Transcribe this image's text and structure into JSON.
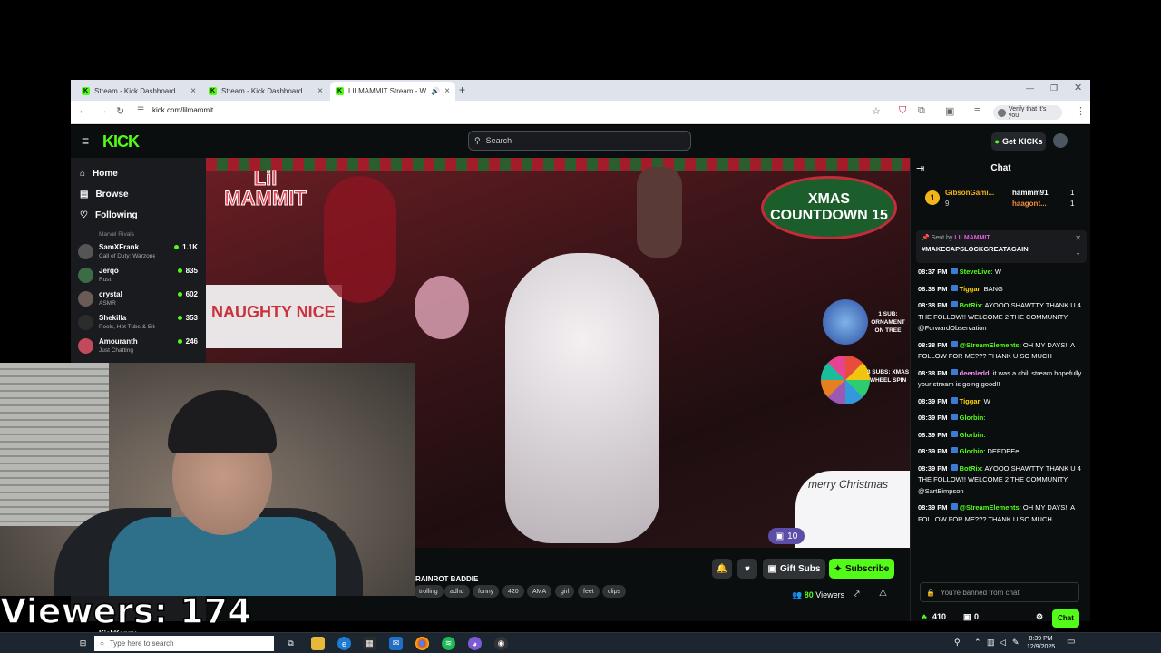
{
  "browser": {
    "tabs": [
      {
        "title": "Stream - Kick Dashboard"
      },
      {
        "title": "Stream - Kick Dashboard"
      },
      {
        "title": "LILMAMMIT Stream - Watc"
      }
    ],
    "url": "kick.com/lilmammit",
    "verify_label": "Verify that it's you"
  },
  "kick": {
    "logo": "KICK",
    "search_placeholder": "Search",
    "get_kicks": "Get KICKs",
    "nav": [
      {
        "label": "Home"
      },
      {
        "label": "Browse"
      },
      {
        "label": "Following"
      }
    ],
    "channels": [
      {
        "name": "Marvel Rivals",
        "game": "",
        "viewers": ""
      },
      {
        "name": "SamXFrank",
        "game": "Call of Duty: Warzone",
        "viewers": "1.1K"
      },
      {
        "name": "Jerqo",
        "game": "Rust",
        "viewers": "835"
      },
      {
        "name": "crystal",
        "game": "ASMR",
        "viewers": "602"
      },
      {
        "name": "Shekilla",
        "game": "Pools, Hot Tubs & Biki...",
        "viewers": "353"
      },
      {
        "name": "Amouranth",
        "game": "Just Chatting",
        "viewers": "246"
      },
      {
        "name": "KickKenny",
        "game": "",
        "viewers": ""
      }
    ],
    "video": {
      "board_text": "NAUGHTY  NICE",
      "countdown": "XMAS COUNTDOWN 15",
      "sub1": "1 SUB: ORNAMENT ON TREE",
      "sub3": "3 SUBS: XMAS WHEEL SPIN",
      "merry": "merry Christmas",
      "sub_count": "10"
    },
    "stream_title": "RAINROT BADDIE",
    "tags": [
      "trolling",
      "adhd",
      "funny",
      "420",
      "AMA",
      "girl",
      "feet",
      "clips"
    ],
    "gift_subs": "Gift Subs",
    "subscribe": "Subscribe",
    "viewers_count": "80",
    "viewers_label": "Viewers"
  },
  "chat": {
    "title": "Chat",
    "gifters": [
      {
        "name": "GibsonGami...",
        "count": "9"
      },
      {
        "name": "hammm91",
        "count": "1"
      },
      {
        "name": "haagont...",
        "count": "1"
      }
    ],
    "pinned_by_label": "Sent by",
    "pinned_by": "LILMAMMIT",
    "pinned_text": "#MAKECAPSLOCKGREATAGAIN",
    "messages": [
      {
        "time": "08:37 PM",
        "user": "SteveLive",
        "text": ": W",
        "color": "#53fc18"
      },
      {
        "time": "08:38 PM",
        "user": "Tiggar",
        "text": ": BANG",
        "color": "#ffd400"
      },
      {
        "time": "08:38 PM",
        "user": "BotRix",
        "text": ": AYOOO SHAWTTY THANK U 4 THE FOLLOW!! WELCOME 2 THE COMMUNITY @ForwardObservation",
        "color": "#53fc18"
      },
      {
        "time": "08:38 PM",
        "user": "@StreamElements",
        "text": ": OH MY DAYS!! A FOLLOW FOR ME??? THANK U SO MUCH",
        "color": "#53fc18"
      },
      {
        "time": "08:38 PM",
        "user": "deenledd",
        "text": ": it was a chill stream hopefully your stream is going good!!",
        "color": "#f28cf5"
      },
      {
        "time": "08:39 PM",
        "user": "Tiggar",
        "text": ": W",
        "color": "#ffd400"
      },
      {
        "time": "08:39 PM",
        "user": "Glorbin",
        "text": ":",
        "color": "#53fc18"
      },
      {
        "time": "08:39 PM",
        "user": "Glorbin",
        "text": ":",
        "color": "#53fc18"
      },
      {
        "time": "08:39 PM",
        "user": "Glorbin",
        "text": ": DEEDEEe",
        "color": "#53fc18"
      },
      {
        "time": "08:39 PM",
        "user": "BotRix",
        "text": ": AYOOO SHAWTTY THANK U 4 THE FOLLOW!! WELCOME 2 THE COMMUNITY @SartBimpson",
        "color": "#53fc18"
      },
      {
        "time": "08:39 PM",
        "user": "@StreamElements",
        "text": ": OH MY DAYS!! A FOLLOW FOR ME??? THANK U SO MUCH",
        "color": "#53fc18"
      }
    ],
    "banned_text": "You're banned from chat",
    "kicks": "410",
    "gifts": "0",
    "send_label": "Chat"
  },
  "overlay": {
    "viewers_text": "Viewers: 174"
  },
  "taskbar": {
    "search_placeholder": "Type here to search",
    "time": "8:39 PM",
    "date": "12/9/2025"
  },
  "colors": {
    "kick_green": "#53fc18",
    "kick_bg": "#0b0e0f",
    "sidebar_bg": "#191b1f"
  }
}
